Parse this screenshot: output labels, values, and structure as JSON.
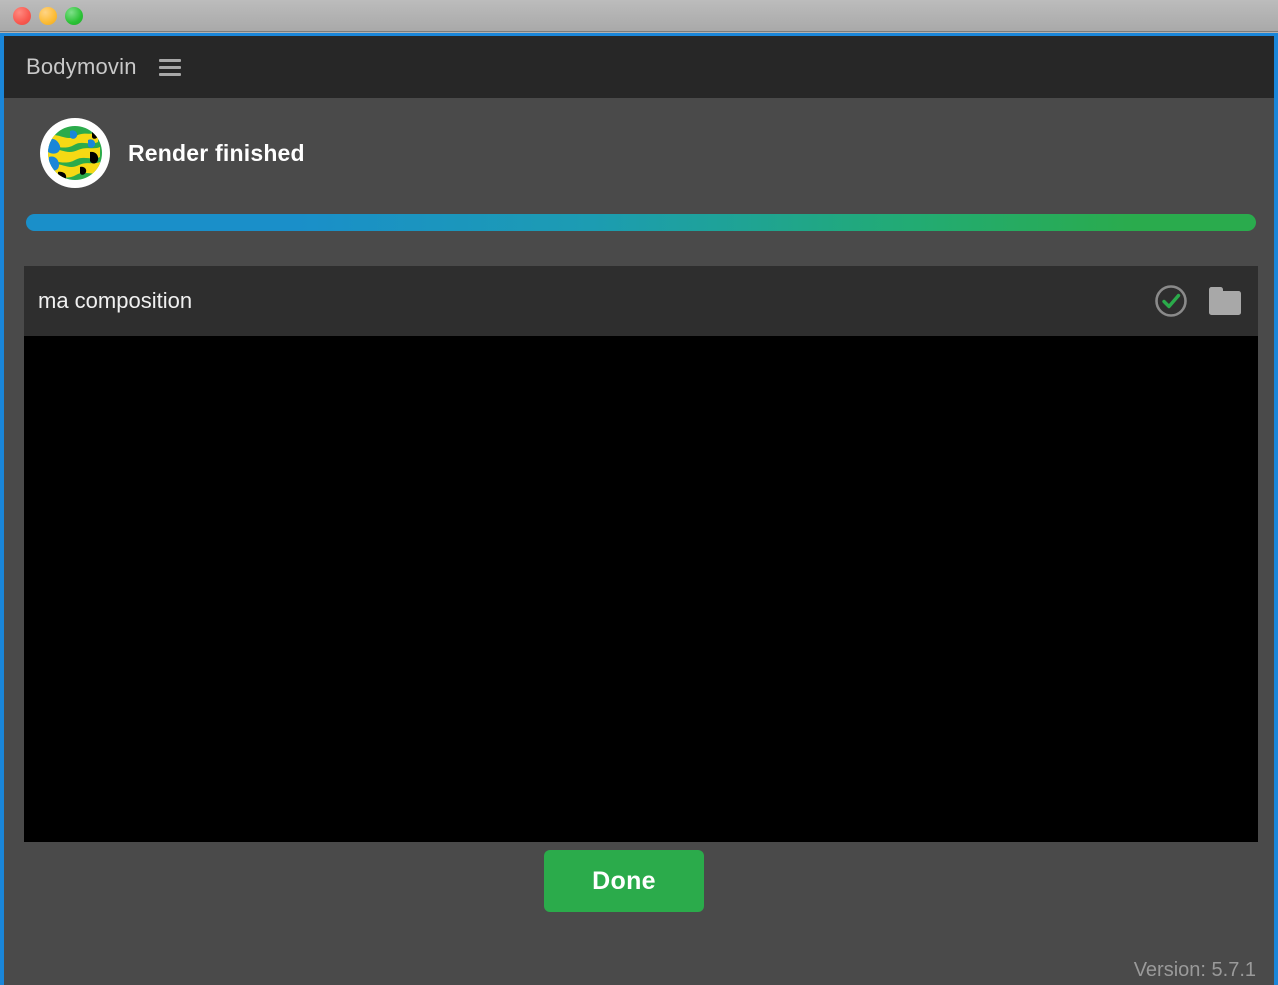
{
  "window": {
    "traffic_lights": [
      {
        "name": "close",
        "color": "#f9584f"
      },
      {
        "name": "minimize",
        "color": "#fcbb34"
      },
      {
        "name": "maximize",
        "color": "#2bc235"
      }
    ],
    "focus_ring_color": "#1a86d9",
    "titlebar_bg": "#b2b2b2"
  },
  "header": {
    "title": "Bodymovin",
    "menu_icon": "hamburger-menu-icon",
    "bg": "#272727",
    "title_color": "#c9c9c9"
  },
  "status": {
    "message": "Render finished",
    "logo_icon": "bodymovin-globe-logo",
    "logo_colors": {
      "ring": "#ffffff",
      "green": "#2bab4b",
      "yellow": "#f5d914",
      "blue": "#1a86d9",
      "black": "#000000"
    }
  },
  "progress": {
    "percent": 100,
    "gradient_start": "#1a8fc9",
    "gradient_end": "#2aab4d",
    "track_bg": "#4a4a4a"
  },
  "composition": {
    "name": "ma composition",
    "status_icon": "check-circle-icon",
    "status_icon_color": "#2bab4b",
    "status_icon_ring_color": "#8a8a8a",
    "folder_icon": "folder-icon",
    "folder_icon_color": "#a8a8a8",
    "card_bg": "#2e2e2e",
    "preview_bg": "#000000"
  },
  "footer": {
    "done_label": "Done",
    "done_color": "#2bab4b",
    "version_label": "Version: 5.7.1",
    "version_color": "#9a9a9a"
  },
  "page_bg": "#4a4a4a"
}
